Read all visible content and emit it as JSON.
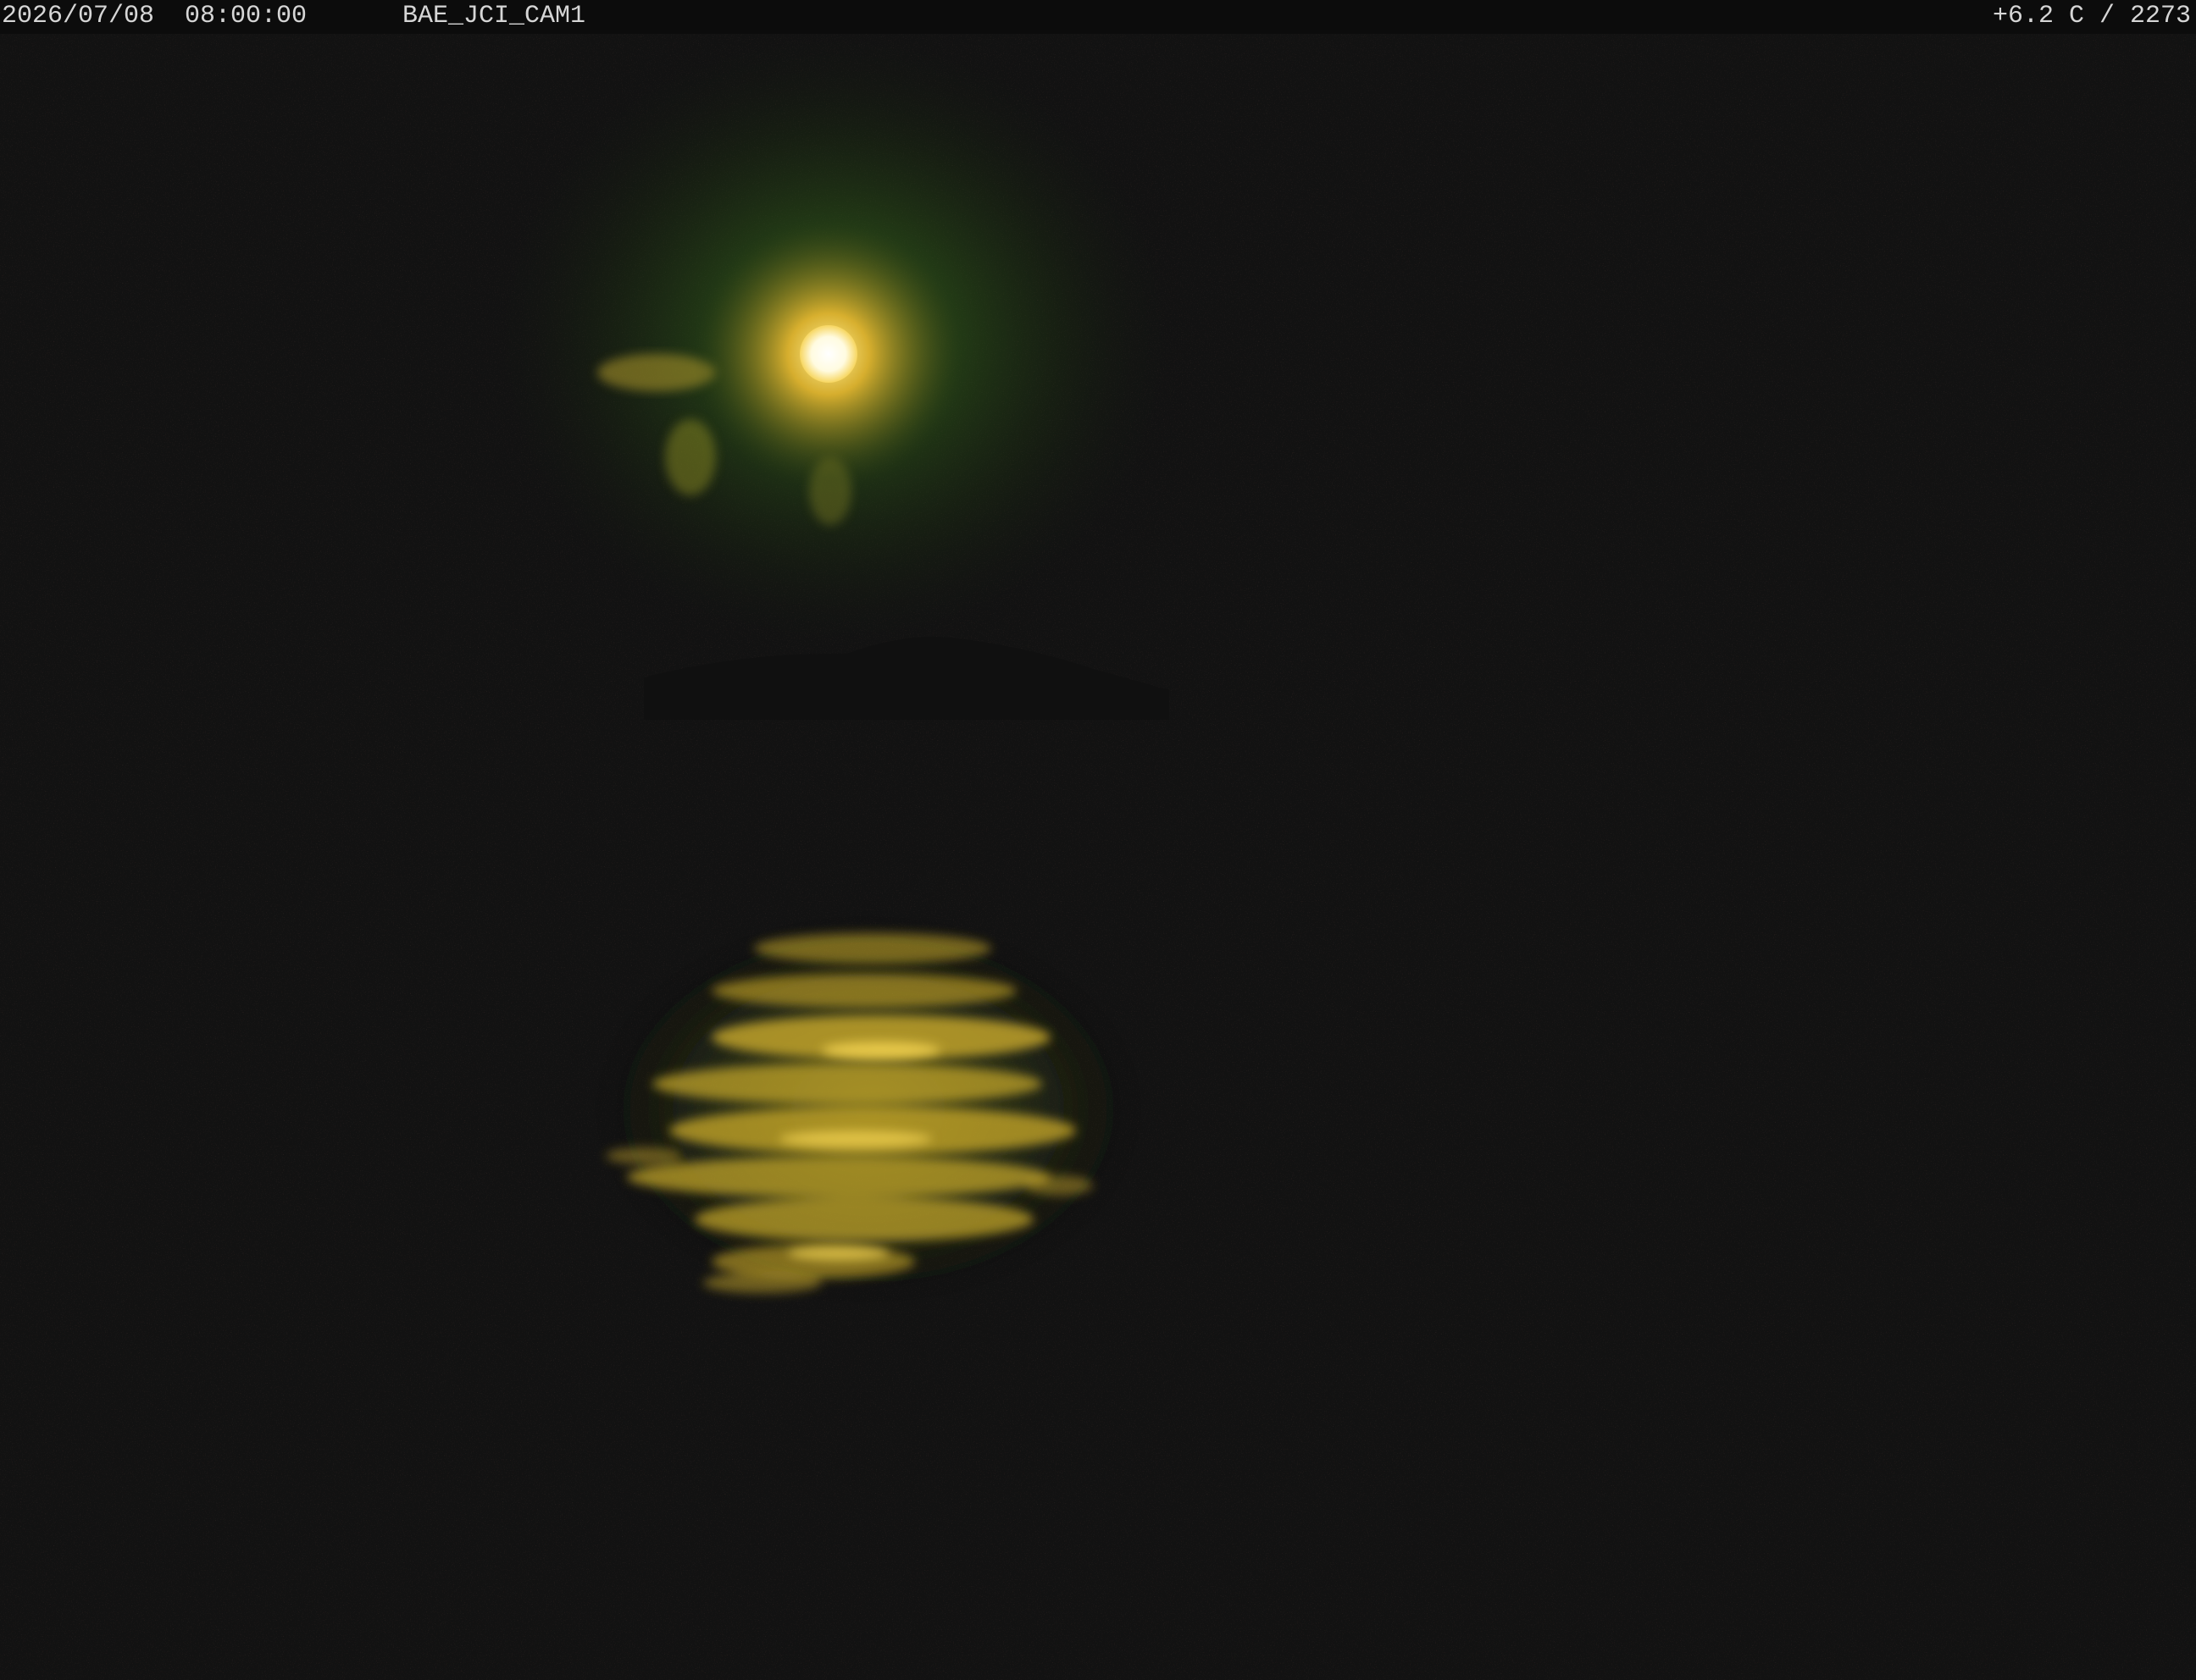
{
  "overlay": {
    "timestamp": "2026/07/08  08:00:00",
    "camera_id": "BAE_JCI_CAM1",
    "reading": "+6.2 C / 2273"
  },
  "scene": {
    "subject": "moon over water with reflection",
    "colors": {
      "background": "#121212",
      "moon_core": "#fffbe0",
      "moon_glow": "#f2c23a",
      "halo_green": "#3f7a1f",
      "reflection": "#c9a92a"
    }
  }
}
